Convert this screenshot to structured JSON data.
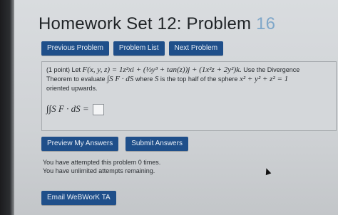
{
  "page": {
    "title": "Homework Set 12: Problem",
    "problem_number": "16"
  },
  "nav": {
    "previous": "Previous Problem",
    "list": "Problem List",
    "next": "Next Problem"
  },
  "problem": {
    "intro": "(1 point) Let",
    "vector_field": "F(x, y, z) = 1z²xi + (⅓y³ + tan(z))j + (1x²z + 2y²)k.",
    "instruction_1": "Use the Divergence",
    "instruction_2": "Theorem to evaluate",
    "integral": "∫S F · dS",
    "where": "where",
    "surface_var": "S",
    "surface_desc": "is the top half of the sphere",
    "sphere_eq": "x² + y² + z² = 1",
    "orientation": "oriented upwards.",
    "answer_label": "∫∫S F · dS =",
    "answer_value": ""
  },
  "actions": {
    "preview": "Preview My Answers",
    "submit": "Submit Answers"
  },
  "attempts": {
    "line1": "You have attempted this problem 0 times.",
    "line2": "You have unlimited attempts remaining."
  },
  "email_ta": "Email WeBWorK TA",
  "colors": {
    "button_bg": "#1f4f8a",
    "problem_number": "#7fa7c9"
  }
}
